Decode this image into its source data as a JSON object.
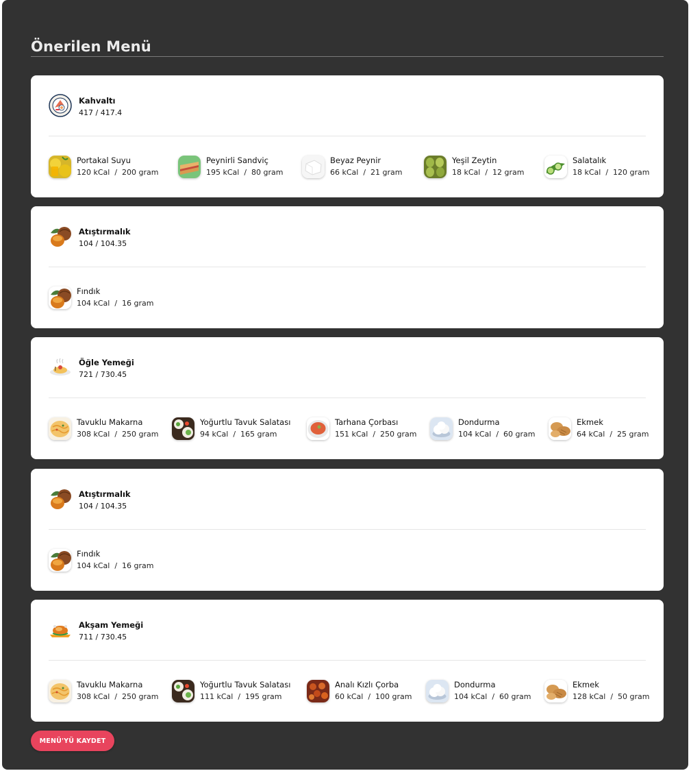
{
  "page_title": "Önerilen Menü",
  "save_button_label": "MENÜ'YÜ KAYDET",
  "colors": {
    "background": "#323232",
    "card": "#ffffff",
    "accent": "#e8445d"
  },
  "meals": [
    {
      "name": "Kahvaltı",
      "kcal": "417 / 417.4",
      "icon": "breakfast-plate-icon",
      "foods": [
        {
          "name": "Portakal Suyu",
          "info": "120 kCal  /  200 gram",
          "icon": "orange-juice-icon"
        },
        {
          "name": "Peynirli Sandviç",
          "info": "195 kCal  /  80 gram",
          "icon": "sandwich-icon"
        },
        {
          "name": "Beyaz Peynir",
          "info": "66 kCal  /  21 gram",
          "icon": "white-cheese-icon"
        },
        {
          "name": "Yeşil Zeytin",
          "info": "18 kCal  /  12 gram",
          "icon": "green-olive-icon"
        },
        {
          "name": "Salatalık",
          "info": "18 kCal  /  120 gram",
          "icon": "cucumber-icon"
        }
      ]
    },
    {
      "name": "Atıştırmalık",
      "kcal": "104 / 104.35",
      "icon": "hazelnut-icon",
      "foods": [
        {
          "name": "Fındık",
          "info": "104 kCal  /  16 gram",
          "icon": "hazelnut-icon"
        }
      ]
    },
    {
      "name": "Öğle Yemeği",
      "kcal": "721 / 730.45",
      "icon": "lunch-plate-icon",
      "foods": [
        {
          "name": "Tavuklu Makarna",
          "info": "308 kCal  /  250 gram",
          "icon": "pasta-icon"
        },
        {
          "name": "Yoğurtlu Tavuk Salatası",
          "info": "94 kCal  /  165 gram",
          "icon": "salad-icon"
        },
        {
          "name": "Tarhana Çorbası",
          "info": "151 kCal  /  250 gram",
          "icon": "soup-icon"
        },
        {
          "name": "Dondurma",
          "info": "104 kCal  /  60 gram",
          "icon": "ice-cream-icon"
        },
        {
          "name": "Ekmek",
          "info": "64 kCal  /  25 gram",
          "icon": "bread-icon"
        }
      ]
    },
    {
      "name": "Atıştırmalık",
      "kcal": "104 / 104.35",
      "icon": "hazelnut-icon",
      "foods": [
        {
          "name": "Fındık",
          "info": "104 kCal  /  16 gram",
          "icon": "hazelnut-icon"
        }
      ]
    },
    {
      "name": "Akşam Yemeği",
      "kcal": "711 / 730.45",
      "icon": "dinner-roast-icon",
      "foods": [
        {
          "name": "Tavuklu Makarna",
          "info": "308 kCal  /  250 gram",
          "icon": "pasta-icon"
        },
        {
          "name": "Yoğurtlu Tavuk Salatası",
          "info": "111 kCal  /  195 gram",
          "icon": "salad-icon"
        },
        {
          "name": "Analı Kızlı Çorba",
          "info": "60 kCal  /  100 gram",
          "icon": "meatball-soup-icon"
        },
        {
          "name": "Dondurma",
          "info": "104 kCal  /  60 gram",
          "icon": "ice-cream-icon"
        },
        {
          "name": "Ekmek",
          "info": "128 kCal  /  50 gram",
          "icon": "bread-icon"
        }
      ]
    }
  ]
}
